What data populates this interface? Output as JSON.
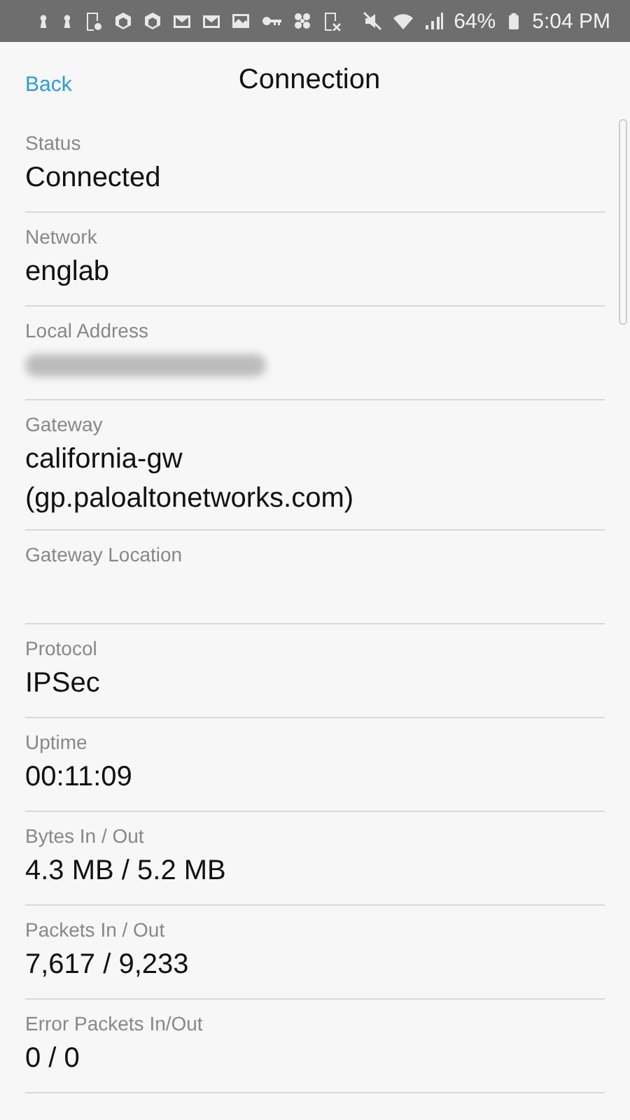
{
  "status_bar": {
    "battery_text": "64%",
    "time": "5:04 PM"
  },
  "header": {
    "back": "Back",
    "title": "Connection"
  },
  "fields": [
    {
      "label": "Status",
      "value": "Connected"
    },
    {
      "label": "Network",
      "value": "englab"
    },
    {
      "label": "Local Address",
      "kind": "blurred"
    },
    {
      "label": "Gateway",
      "value": "california-gw (gp.paloaltonetworks.com)"
    },
    {
      "label": "Gateway Location"
    },
    {
      "label": "Protocol",
      "value": "IPSec"
    },
    {
      "label": "Uptime",
      "value": "00:11:09"
    },
    {
      "label": "Bytes In / Out",
      "value": "4.3 MB / 5.2 MB"
    },
    {
      "label": "Packets In / Out",
      "value": "7,617 / 9,233"
    },
    {
      "label": "Error Packets In/Out",
      "value": "0 / 0"
    }
  ]
}
